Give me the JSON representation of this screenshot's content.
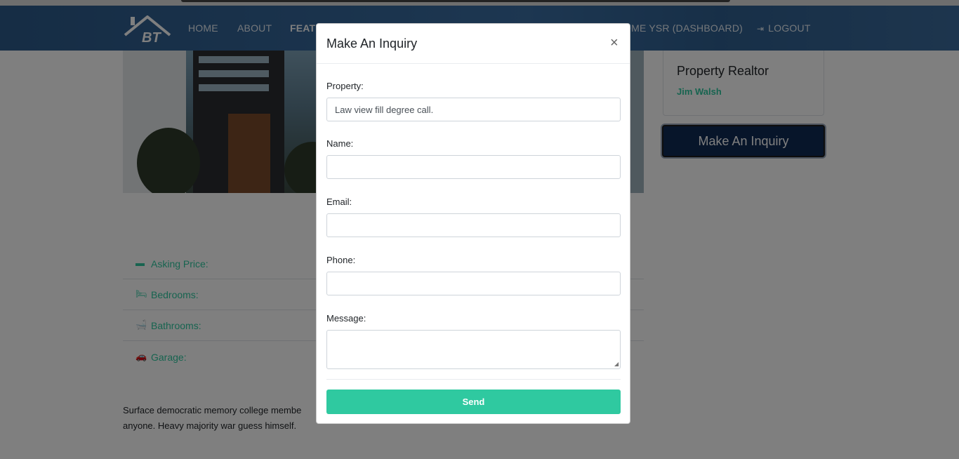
{
  "navbar": {
    "logo_text": "BT",
    "links": [
      {
        "label": "HOME"
      },
      {
        "label": "ABOUT"
      },
      {
        "label": "FEATU"
      },
      {
        "label": "OME YSR (DASHBOARD)"
      },
      {
        "label": "LOGOUT",
        "icon": "sign-out-icon"
      }
    ]
  },
  "sidebar": {
    "card_title": "Property Realtor",
    "realtor_name": "Jim Walsh",
    "inquiry_button": "Make An Inquiry"
  },
  "details": [
    {
      "icon": "money-icon",
      "glyph": "▬",
      "label": "Asking Price:"
    },
    {
      "icon": "bed-icon",
      "glyph": "🛏",
      "label": "Bedrooms:"
    },
    {
      "icon": "bath-icon",
      "glyph": "🛁",
      "label": "Bathrooms:"
    },
    {
      "icon": "car-icon",
      "glyph": "🚗",
      "label": "Garage:"
    }
  ],
  "description": {
    "line1": "Surface democratic memory college membe",
    "line2": "anyone. Heavy majority war guess himself."
  },
  "modal": {
    "title": "Make An Inquiry",
    "close": "×",
    "property_label": "Property:",
    "property_value": "Law view fill degree call.",
    "name_label": "Name:",
    "name_value": "",
    "email_label": "Email:",
    "email_value": "",
    "phone_label": "Phone:",
    "phone_value": "",
    "message_label": "Message:",
    "message_value": "",
    "send_label": "Send"
  },
  "colors": {
    "accent": "#2fc9a0",
    "navbar": "#2d5d8f",
    "inquiry_button": "#0f2a55"
  }
}
